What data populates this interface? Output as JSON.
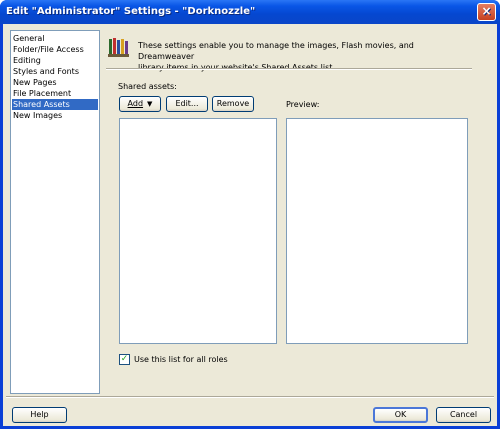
{
  "window": {
    "title": "Edit \"Administrator\" Settings - \"Dorknozzle\"",
    "close_glyph": "×"
  },
  "categories": [
    {
      "label": "General",
      "selected": false
    },
    {
      "label": "Folder/File Access",
      "selected": false
    },
    {
      "label": "Editing",
      "selected": false
    },
    {
      "label": "Styles and Fonts",
      "selected": false
    },
    {
      "label": "New Pages",
      "selected": false
    },
    {
      "label": "File Placement",
      "selected": false
    },
    {
      "label": "Shared Assets",
      "selected": true
    },
    {
      "label": "New Images",
      "selected": false
    }
  ],
  "panel": {
    "icon": "library-books-icon",
    "intro_line1": "These settings enable you to manage the images, Flash movies, and Dreamweaver",
    "intro_line2": "library items in your website's Shared Assets list.",
    "shared_assets_label": "Shared assets:",
    "preview_label": "Preview:",
    "add_label": "Add",
    "edit_label": "Edit...",
    "remove_label": "Remove",
    "use_list_label": "Use this list for all roles",
    "use_list_checked": true
  },
  "footer": {
    "help_label": "Help",
    "ok_label": "OK",
    "cancel_label": "Cancel"
  }
}
